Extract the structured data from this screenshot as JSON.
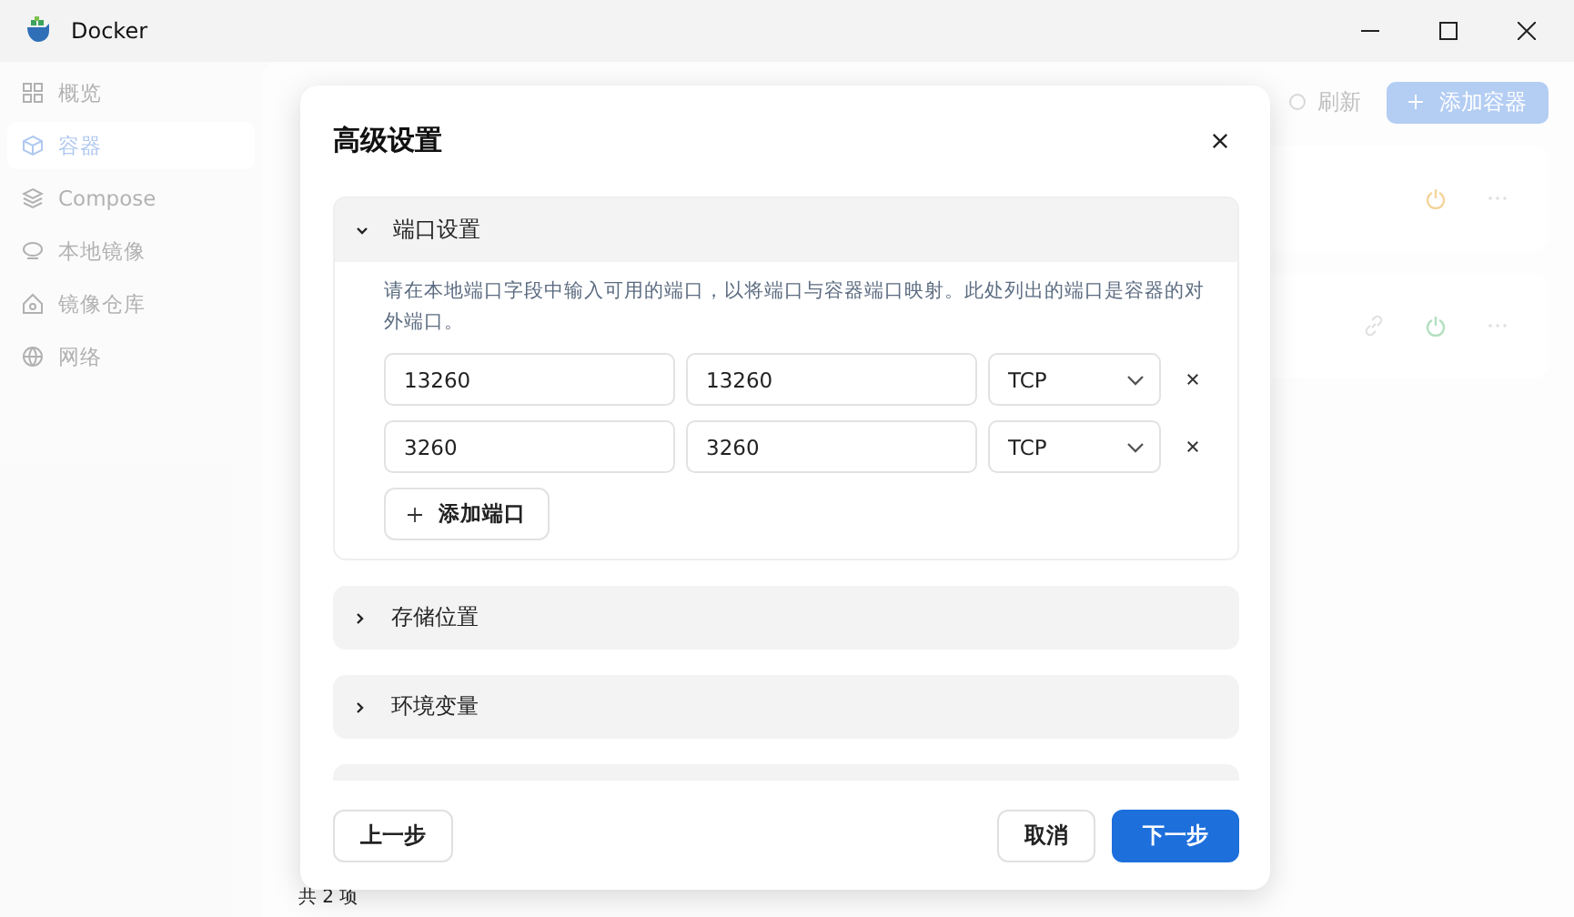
{
  "window": {
    "title": "Docker"
  },
  "sidebar": {
    "items": [
      {
        "label": "概览",
        "selected": false
      },
      {
        "label": "容器",
        "selected": true
      },
      {
        "label": "Compose",
        "selected": false
      },
      {
        "label": "本地镜像",
        "selected": false
      },
      {
        "label": "镜像仓库",
        "selected": false
      },
      {
        "label": "网络",
        "selected": false
      }
    ]
  },
  "main": {
    "refresh_button": "刷新",
    "add_button": "添加容器",
    "footer": "共 2 项",
    "containers": [
      {
        "linked": false,
        "color": "#f3d49a"
      },
      {
        "linked": true,
        "color": "#b2dfbf"
      }
    ]
  },
  "dialog": {
    "title": "高级设置",
    "sections": [
      {
        "title": "端口设置",
        "expanded": true
      },
      {
        "title": "存储位置",
        "expanded": false
      },
      {
        "title": "环境变量",
        "expanded": false
      }
    ],
    "description": "请在本地端口字段中输入可用的端口，以将端口与容器端口映射。此处列出的端口是容器的对外端口。",
    "ports": [
      {
        "local": "13260",
        "container": "13260",
        "protocol": "TCP"
      },
      {
        "local": "3260",
        "container": "3260",
        "protocol": "TCP"
      }
    ],
    "add_port_button": "添加端口",
    "buttons": {
      "back": "上一步",
      "cancel": "取消",
      "next": "下一步"
    }
  }
}
